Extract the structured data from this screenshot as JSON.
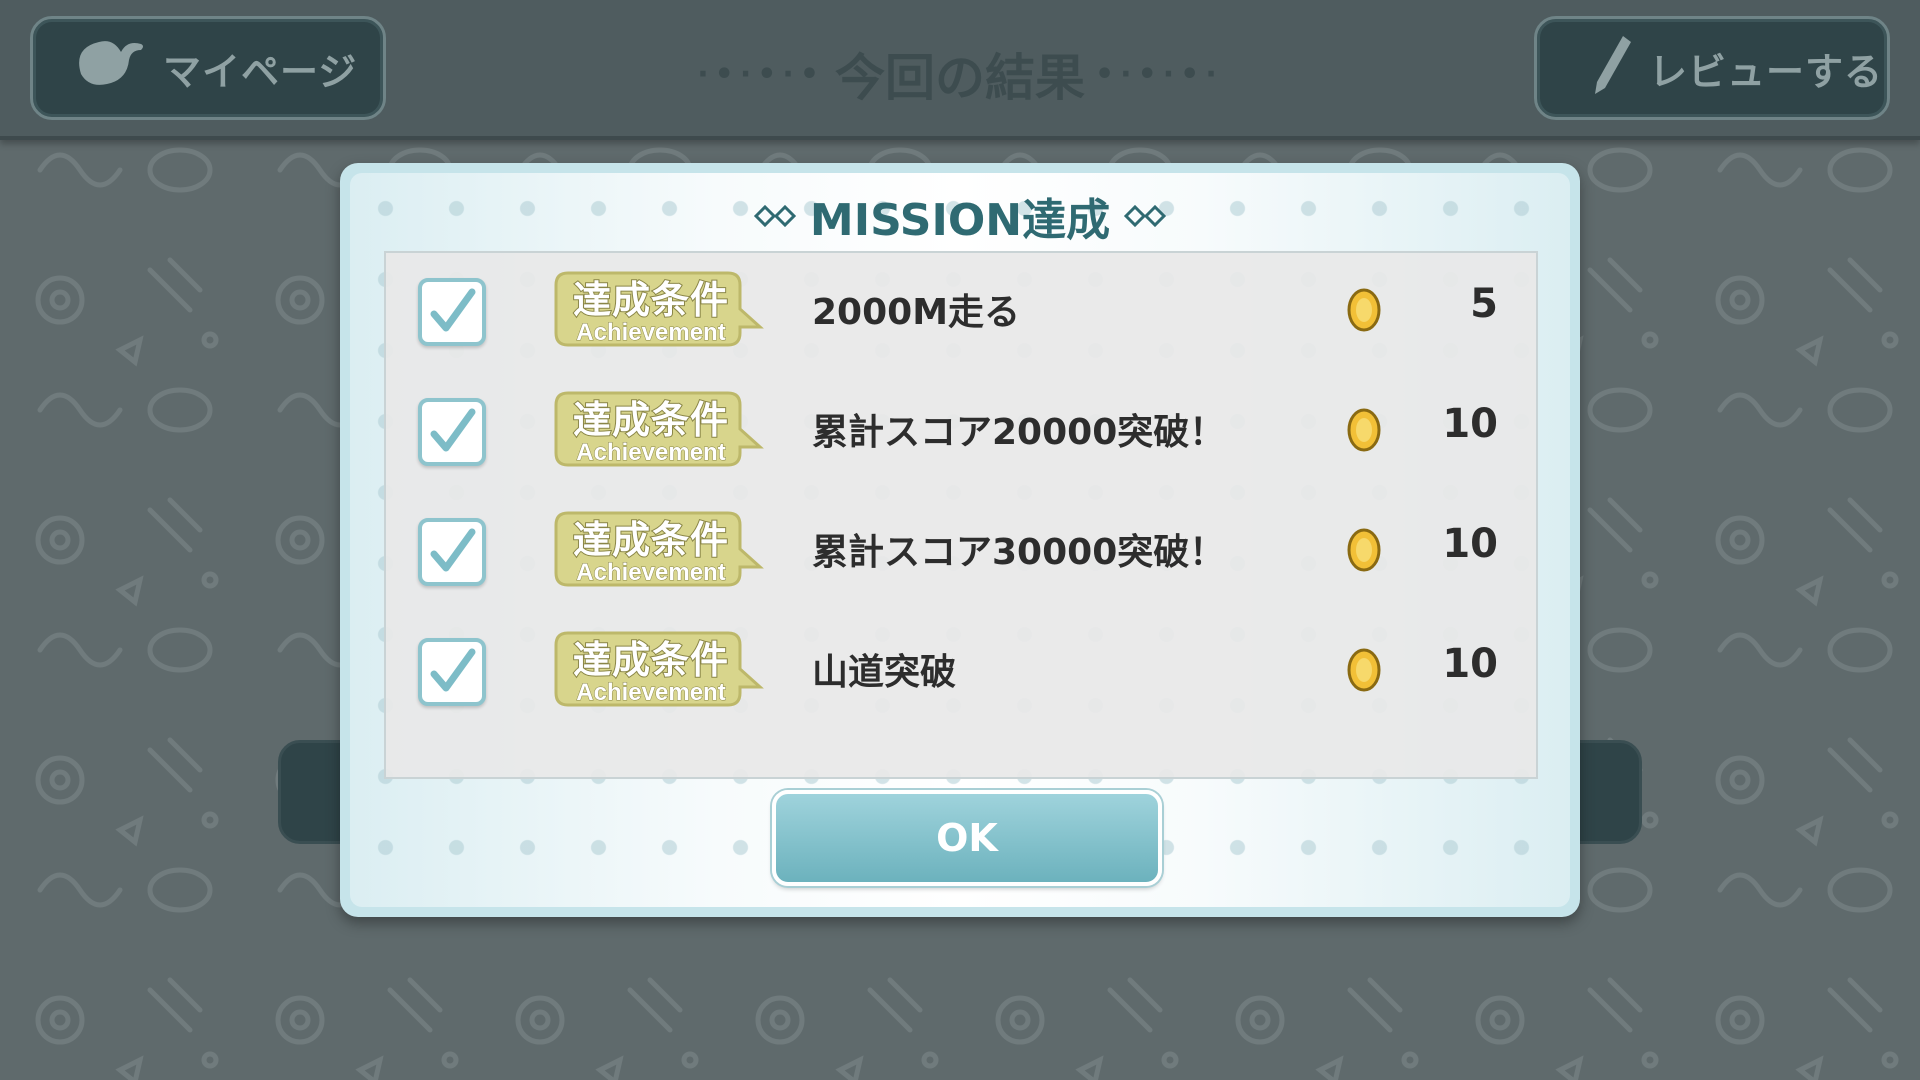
{
  "header": {
    "mypage_label": "マイページ",
    "title": "今回の結果",
    "review_label": "レビューする"
  },
  "modal": {
    "title": "MISSION達成",
    "ok_label": "OK",
    "badge_jp": "達成条件",
    "badge_en": "Achievement"
  },
  "missions": [
    {
      "text": "2000M走る",
      "reward": "5",
      "completed": true
    },
    {
      "text": "累計スコア20000突破！",
      "reward": "10",
      "completed": true
    },
    {
      "text": "累計スコア30000突破！",
      "reward": "10",
      "completed": true
    },
    {
      "text": "山道突破",
      "reward": "10",
      "completed": true
    }
  ],
  "colors": {
    "accent": "#8ec4cd",
    "title_text": "#2f6a72",
    "ok_button": "#6cb2bd",
    "badge": "#d8d58c"
  },
  "icons": {
    "mypage": "character-head-icon",
    "review": "pencil-icon",
    "reward": "gold-coin-icon",
    "check": "checkmark-icon"
  }
}
